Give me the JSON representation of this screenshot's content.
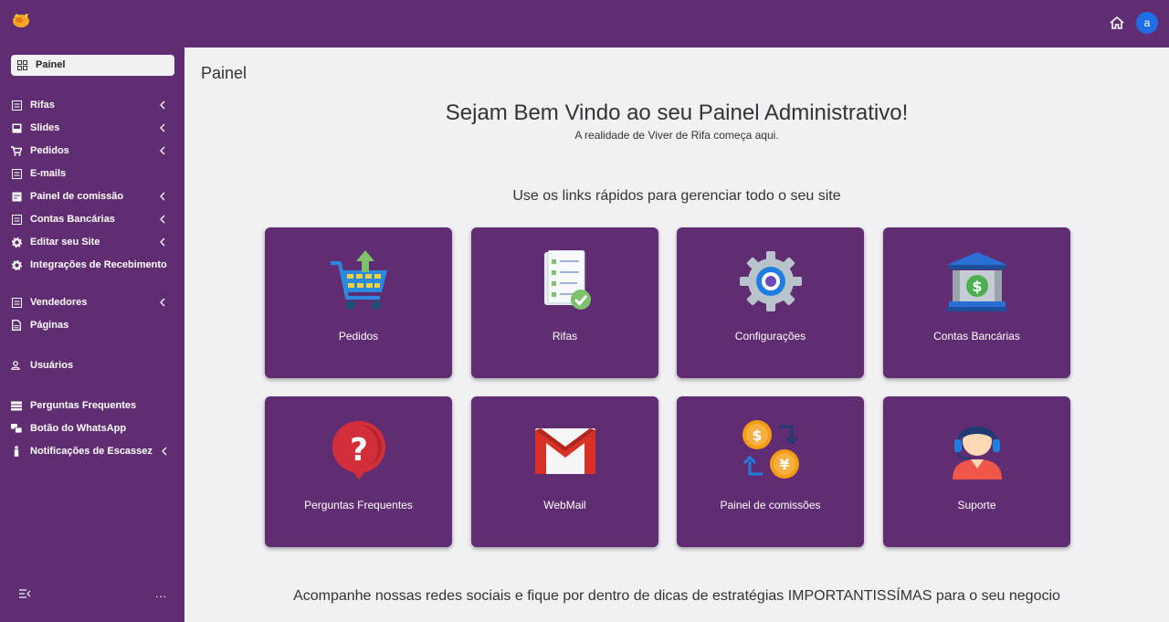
{
  "topbar": {
    "home_icon": "home-icon",
    "avatar_letter": "a",
    "avatar_color": "#1e6fe6"
  },
  "brand_color": "#612d72",
  "sidebar": {
    "items": [
      {
        "label": "Painel",
        "icon": "grid-icon",
        "active": true
      },
      {
        "label": "Rifas",
        "icon": "list-icon",
        "chevron": true
      },
      {
        "label": "Slides",
        "icon": "slides-icon",
        "chevron": true
      },
      {
        "label": "Pedidos",
        "icon": "cart-icon",
        "chevron": true
      },
      {
        "label": "E-mails",
        "icon": "list-icon"
      },
      {
        "label": "Painel de comissão",
        "icon": "doc-icon",
        "chevron": true
      },
      {
        "label": "Contas Bancárias",
        "icon": "list-icon",
        "chevron": true
      },
      {
        "label": "Editar seu Site",
        "icon": "gear-icon",
        "chevron": true
      },
      {
        "label": "Integrações de Recebimento",
        "icon": "gear-icon"
      },
      {
        "label": "Vendedores",
        "icon": "list-icon",
        "chevron": true
      },
      {
        "label": "Páginas",
        "icon": "page-icon"
      },
      {
        "label": "Usuários",
        "icon": "users-icon"
      },
      {
        "label": "Perguntas Frequentes",
        "icon": "faq-icon"
      },
      {
        "label": "Botão do WhatsApp",
        "icon": "chat-icon"
      },
      {
        "label": "Notificações de Escassez",
        "icon": "person-icon",
        "chevron": true
      }
    ],
    "more_label": "..."
  },
  "main": {
    "title": "Painel",
    "welcome": "Sejam Bem Vindo ao seu Painel Administrativo!",
    "welcome_sub": "A realidade de Viver de Rifa começa aqui.",
    "quick_title": "Use os links rápidos para gerenciar todo o seu site",
    "cards": [
      {
        "label": "Pedidos",
        "icon": "shopping-cart-icon"
      },
      {
        "label": "Rifas",
        "icon": "checklist-icon"
      },
      {
        "label": "Configurações",
        "icon": "settings-gear-icon"
      },
      {
        "label": "Contas Bancárias",
        "icon": "bank-icon"
      },
      {
        "label": "Perguntas Frequentes",
        "icon": "question-icon"
      },
      {
        "label": "WebMail",
        "icon": "gmail-icon"
      },
      {
        "label": "Painel de comissões",
        "icon": "coins-exchange-icon"
      },
      {
        "label": "Suporte",
        "icon": "support-agent-icon"
      }
    ],
    "social_text": "Acompanhe nossas redes sociais e fique por dentro de dicas de estratégias IMPORTANTISSÍMAS para o seu negocio"
  }
}
